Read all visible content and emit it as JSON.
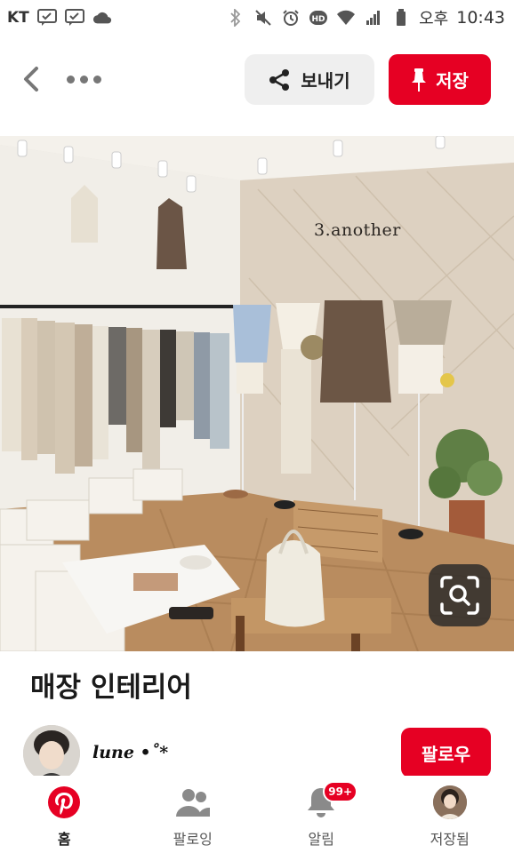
{
  "status_bar": {
    "carrier": "KT",
    "ampm": "오후",
    "time": "10:43",
    "icons": [
      "message-icon",
      "message-icon",
      "cloud-icon",
      "bluetooth-icon",
      "mute-icon",
      "alarm-icon",
      "hd-icon",
      "wifi-icon",
      "signal-icon",
      "battery-icon"
    ]
  },
  "top_bar": {
    "share_label": "보내기",
    "save_label": "저장"
  },
  "pin": {
    "store_sign": "3.another",
    "title": "매장 인테리어",
    "creator_name": "lune •˚*",
    "follow_label": "팔로우"
  },
  "bottom_nav": {
    "items": [
      {
        "label": "홈",
        "icon": "pinterest-logo-icon",
        "active": true
      },
      {
        "label": "팔로잉",
        "icon": "people-icon",
        "active": false
      },
      {
        "label": "알림",
        "icon": "bell-icon",
        "badge": "99+",
        "active": false
      },
      {
        "label": "저장됨",
        "icon": "profile-avatar-icon",
        "active": false
      }
    ]
  },
  "colors": {
    "brand_red": "#e60023",
    "share_bg": "#efefef"
  }
}
